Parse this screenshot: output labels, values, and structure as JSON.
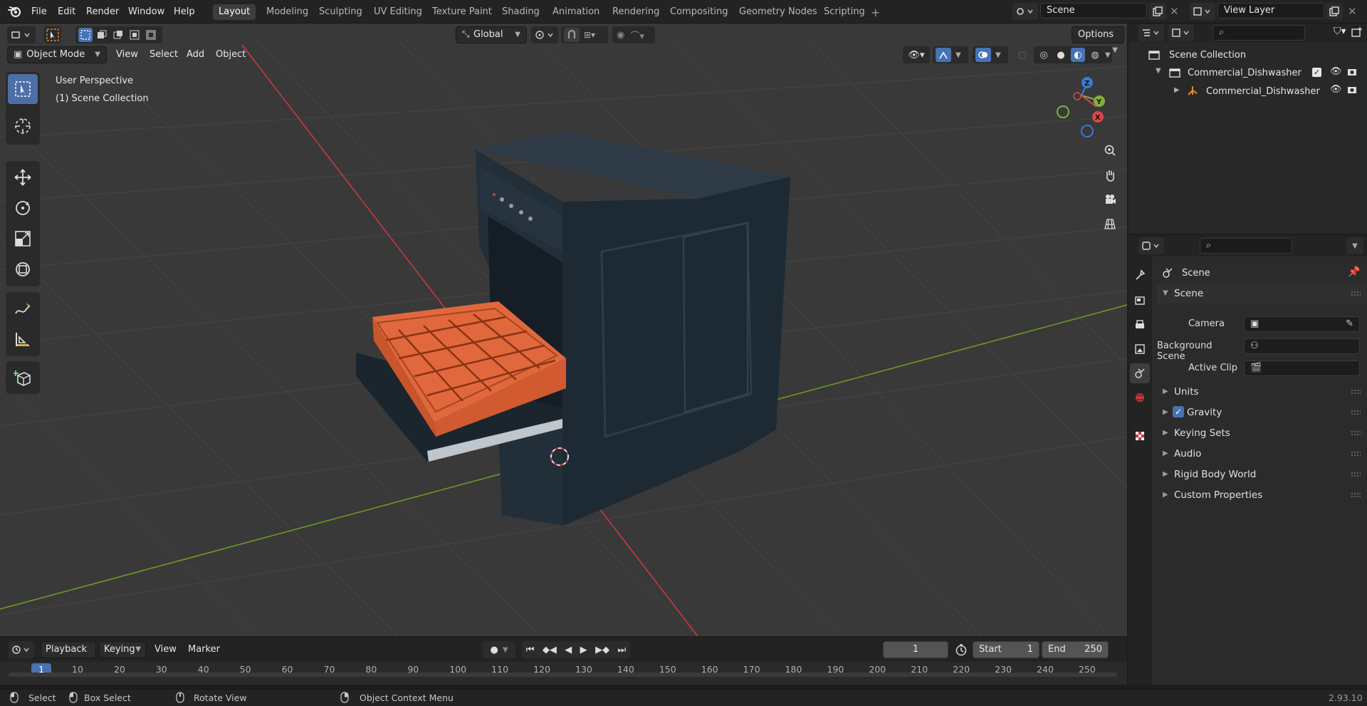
{
  "menubar": {
    "items": [
      "File",
      "Edit",
      "Render",
      "Window",
      "Help"
    ],
    "workspaces": [
      "Layout",
      "Modeling",
      "Sculpting",
      "UV Editing",
      "Texture Paint",
      "Shading",
      "Animation",
      "Rendering",
      "Compositing",
      "Geometry Nodes",
      "Scripting"
    ],
    "active_workspace": "Layout",
    "scene": "Scene",
    "view_layer": "View Layer"
  },
  "viewport_header": {
    "mode": "Object Mode",
    "menus": [
      "View",
      "Select",
      "Add",
      "Object"
    ],
    "transform_orientation": "Global",
    "options_label": "Options"
  },
  "viewport": {
    "perspective_label": "User Perspective",
    "collection_label": "(1) Scene Collection",
    "gizmo_axes": [
      "X",
      "Y",
      "Z"
    ]
  },
  "outliner": {
    "root": "Scene Collection",
    "collection": "Commercial_Dishwasher",
    "object": "Commercial_Dishwasher"
  },
  "properties": {
    "context_title": "Scene",
    "panel_title": "Scene",
    "rows": [
      {
        "label": "Camera"
      },
      {
        "label": "Background Scene"
      },
      {
        "label": "Active Clip"
      }
    ],
    "subpanels": [
      "Units",
      "Gravity",
      "Keying Sets",
      "Audio",
      "Rigid Body World",
      "Custom Properties"
    ],
    "gravity_checked": true
  },
  "timeline": {
    "menus": [
      "Playback",
      "Keying",
      "View",
      "Marker"
    ],
    "current_frame": "1",
    "start_label": "Start",
    "start_value": "1",
    "end_label": "End",
    "end_value": "250",
    "ruler_ticks": [
      "1",
      "10",
      "20",
      "30",
      "40",
      "50",
      "60",
      "70",
      "80",
      "90",
      "100",
      "110",
      "120",
      "130",
      "140",
      "150",
      "160",
      "170",
      "180",
      "190",
      "200",
      "210",
      "220",
      "230",
      "240",
      "250"
    ]
  },
  "statusbar": {
    "items": [
      "Select",
      "Box Select",
      "Rotate View",
      "Object Context Menu"
    ],
    "version": "2.93.10"
  },
  "colors": {
    "accent": "#4772b3",
    "viewport_bg": "#393939",
    "x_axis": "#c9383f",
    "y_axis": "#6d9a21",
    "basket": "#e0683c"
  }
}
